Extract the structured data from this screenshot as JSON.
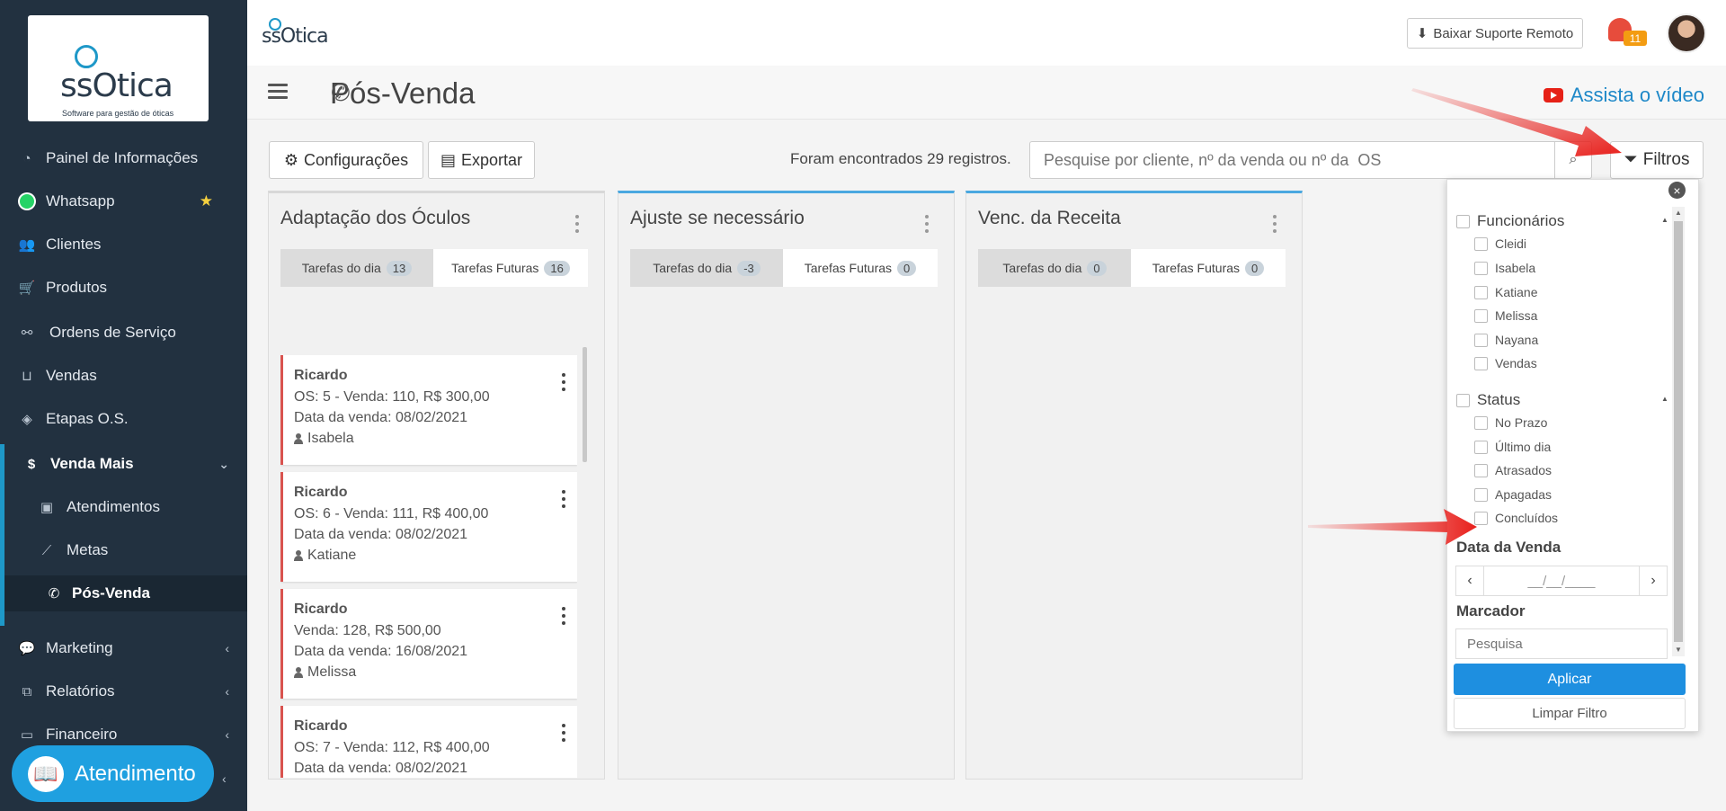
{
  "sidebar": {
    "logo_text": "ssOtica",
    "logo_subtitle": "Software para gestão de óticas",
    "items": [
      {
        "label": "Painel de Informações",
        "icon": "dashboard-icon"
      },
      {
        "label": "Whatsapp",
        "icon": "whatsapp-icon"
      },
      {
        "label": "Clientes",
        "icon": "users-icon"
      },
      {
        "label": "Produtos",
        "icon": "cart-icon"
      },
      {
        "label": "Ordens de Serviço",
        "icon": "glasses-icon"
      },
      {
        "label": "Vendas",
        "icon": "basket-icon"
      },
      {
        "label": "Etapas O.S.",
        "icon": "tags-icon"
      },
      {
        "label": "Venda Mais",
        "icon": "dollar-icon"
      },
      {
        "label": "Atendimentos",
        "icon": "clipboard-icon"
      },
      {
        "label": "Metas",
        "icon": "chart-line-icon"
      },
      {
        "label": "Pós-Venda",
        "icon": "phone-icon"
      },
      {
        "label": "Marketing",
        "icon": "comments-icon"
      },
      {
        "label": "Relatórios",
        "icon": "copy-icon"
      },
      {
        "label": "Financeiro",
        "icon": "money-icon"
      }
    ],
    "atendimento_label": "Atendimento"
  },
  "topbar": {
    "logo_text": "ssOtica",
    "suporte_label": "Baixar Suporte Remoto",
    "notification_count": "11"
  },
  "header": {
    "title": "Pós-Venda",
    "video_label": "Assista o vídeo"
  },
  "toolbar": {
    "config_label": "Configurações",
    "export_label": "Exportar",
    "records_text": "Foram encontrados 29 registros.",
    "search_placeholder": "Pesquise por cliente, nº da venda ou nº da  OS",
    "filtros_label": "Filtros"
  },
  "columns": [
    {
      "title": "Adaptação dos Óculos",
      "tab_today": "Tarefas do dia",
      "count_today": "13",
      "tab_future": "Tarefas Futuras",
      "count_future": "16",
      "cards": [
        {
          "name": "Ricardo",
          "line1": "OS: 5 - Venda: 110, R$ 300,00",
          "line2": "Data da venda: 08/02/2021",
          "user": "Isabela"
        },
        {
          "name": "Ricardo",
          "line1": "OS: 6 - Venda: 111, R$ 400,00",
          "line2": "Data da venda: 08/02/2021",
          "user": "Katiane"
        },
        {
          "name": "Ricardo",
          "line1": "Venda: 128, R$ 500,00",
          "line2": "Data da venda: 16/08/2021",
          "user": "Melissa"
        },
        {
          "name": "Ricardo",
          "line1": "OS: 7 - Venda: 112, R$ 400,00",
          "line2": "Data da venda: 08/02/2021",
          "user": ""
        }
      ]
    },
    {
      "title": "Ajuste se necessário",
      "tab_today": "Tarefas do dia",
      "count_today": "-3",
      "tab_future": "Tarefas Futuras",
      "count_future": "0"
    },
    {
      "title": "Venc. da Receita",
      "tab_today": "Tarefas do dia",
      "count_today": "0",
      "tab_future": "Tarefas Futuras",
      "count_future": "0"
    }
  ],
  "filters": {
    "funcionarios_label": "Funcionários",
    "funcionarios": [
      "Cleidi",
      "Isabela",
      "Katiane",
      "Melissa",
      "Nayana",
      "Vendas"
    ],
    "status_label": "Status",
    "status": [
      "No Prazo",
      "Último dia",
      "Atrasados",
      "Apagadas",
      "Concluídos"
    ],
    "data_venda_label": "Data da Venda",
    "date_placeholder": "__/__/____",
    "marcador_label": "Marcador",
    "marcador_placeholder": "Pesquisa",
    "aplicar_label": "Aplicar",
    "limpar_label": "Limpar Filtro"
  },
  "colors": {
    "sidebar_bg": "#223140",
    "accent": "#1e8fe0",
    "card_border": "#d9534f",
    "annotation_arrow": "#e8201c"
  }
}
